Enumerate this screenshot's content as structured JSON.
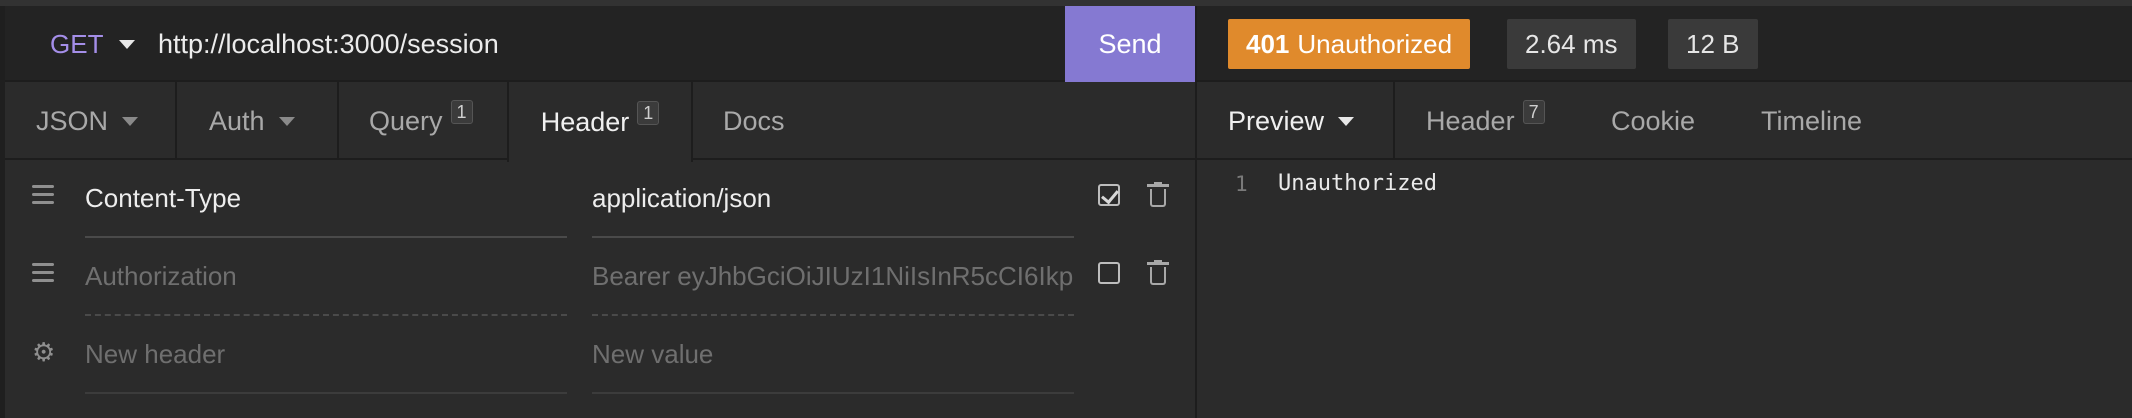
{
  "request": {
    "method": "GET",
    "url": "http://localhost:3000/session",
    "send_label": "Send"
  },
  "request_tabs": [
    {
      "label": "JSON",
      "dropdown": true
    },
    {
      "label": "Auth",
      "dropdown": true
    },
    {
      "label": "Query",
      "count": "1"
    },
    {
      "label": "Header",
      "count": "1",
      "active": true
    },
    {
      "label": "Docs"
    }
  ],
  "headers": [
    {
      "name": "Content-Type",
      "value": "application/json",
      "enabled": true
    },
    {
      "name": "Authorization",
      "value": "Bearer eyJhbGciOiJIUzI1NiIsInR5cCI6Ikp",
      "enabled": false
    }
  ],
  "new_header": {
    "name_placeholder": "New header",
    "value_placeholder": "New value"
  },
  "response": {
    "status_code": "401",
    "status_text": "Unauthorized",
    "status_color": "#e08a2c",
    "time": "2.64 ms",
    "size": "12 B"
  },
  "response_tabs": [
    {
      "label": "Preview",
      "dropdown": true,
      "active": true
    },
    {
      "label": "Header",
      "count": "7"
    },
    {
      "label": "Cookie"
    },
    {
      "label": "Timeline"
    }
  ],
  "preview": {
    "line_number": "1",
    "body": "Unauthorized"
  },
  "colors": {
    "accent": "#8579d2",
    "method": "#a48ee8",
    "background": "#2b2b2b"
  }
}
